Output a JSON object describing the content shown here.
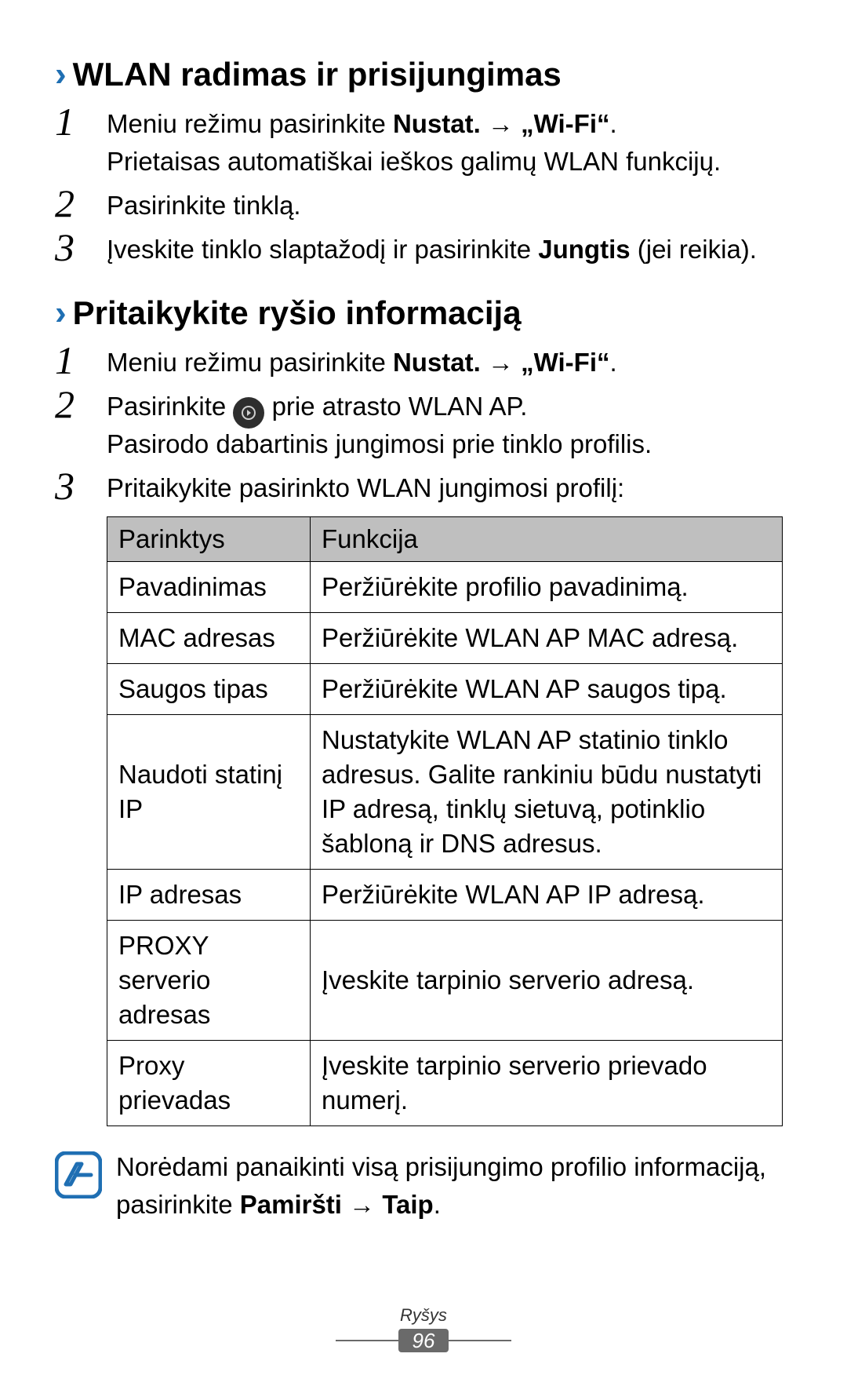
{
  "section1": {
    "title": "WLAN radimas ir prisijungimas",
    "steps": [
      {
        "pre": "Meniu režimu pasirinkite ",
        "bold1": "Nustat.",
        "arrow": " → ",
        "bold2": "„Wi-Fi“",
        "post": ".",
        "line2": "Prietaisas automatiškai ieškos galimų WLAN funkcijų."
      },
      {
        "text": "Pasirinkite tinklą."
      },
      {
        "pre": "Įveskite tinklo slaptažodį ir pasirinkite ",
        "bold1": "Jungtis",
        "post": " (jei reikia)."
      }
    ]
  },
  "section2": {
    "title": "Pritaikykite ryšio informaciją",
    "step1": {
      "pre": "Meniu režimu pasirinkite ",
      "bold1": "Nustat.",
      "arrow": " → ",
      "bold2": "„Wi-Fi“",
      "post": "."
    },
    "step2": {
      "pre": "Pasirinkite ",
      "post": " prie atrasto WLAN AP.",
      "line2": "Pasirodo dabartinis jungimosi prie tinklo profilis."
    },
    "step3": {
      "text": "Pritaikykite pasirinkto WLAN jungimosi profilį:"
    },
    "table": {
      "headers": [
        "Parinktys",
        "Funkcija"
      ],
      "rows": [
        [
          "Pavadinimas",
          "Peržiūrėkite profilio pavadinimą."
        ],
        [
          "MAC adresas",
          "Peržiūrėkite WLAN AP MAC adresą."
        ],
        [
          "Saugos tipas",
          "Peržiūrėkite WLAN AP saugos tipą."
        ],
        [
          "Naudoti statinį IP",
          "Nustatykite WLAN AP statinio tinklo adresus. Galite rankiniu būdu nustatyti IP adresą, tinklų sietuvą, potinklio šabloną ir DNS adresus."
        ],
        [
          "IP adresas",
          "Peržiūrėkite WLAN AP IP adresą."
        ],
        [
          "PROXY serverio adresas",
          "Įveskite tarpinio serverio adresą."
        ],
        [
          "Proxy prievadas",
          "Įveskite tarpinio serverio prievado numerį."
        ]
      ]
    }
  },
  "note": {
    "pre": "Norėdami panaikinti visą prisijungimo profilio informaciją, pasirinkite ",
    "bold1": "Pamiršti",
    "arrow": " → ",
    "bold2": "Taip",
    "post": "."
  },
  "footer": {
    "label": "Ryšys",
    "page": "96"
  }
}
